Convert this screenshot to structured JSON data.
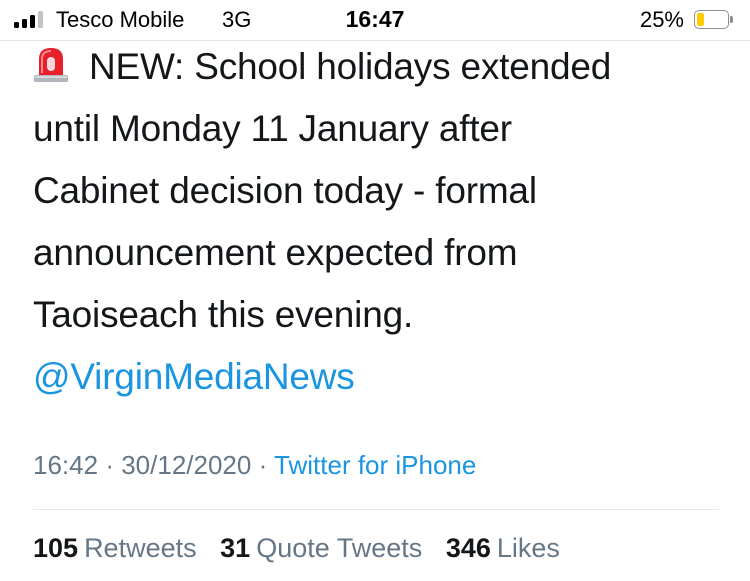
{
  "status_bar": {
    "carrier": "Tesco Mobile",
    "network": "3G",
    "time": "16:47",
    "battery": "25%",
    "battery_level": 0.25,
    "battery_color": "#ffcc00",
    "signal_bars_active": 3,
    "signal_bars_total": 4
  },
  "tweet": {
    "emoji_icon": "police-car-light-icon",
    "lines": [
      "NEW: School holidays extended",
      "until Monday 11 January after",
      "Cabinet decision today - formal",
      "announcement expected from",
      "Taoiseach this evening."
    ],
    "mention": "@VirginMediaNews"
  },
  "meta": {
    "time": "16:42",
    "sep1": "·",
    "date": "30/12/2020",
    "sep2": "·",
    "source": "Twitter for iPhone"
  },
  "stats": {
    "retweets": {
      "count": "105",
      "label": "Retweets"
    },
    "quote_tweets": {
      "count": "31",
      "label": "Quote Tweets"
    },
    "likes": {
      "count": "346",
      "label": "Likes"
    }
  },
  "colors": {
    "text": "#14171a",
    "secondary": "#657786",
    "link": "#1b95e0"
  }
}
